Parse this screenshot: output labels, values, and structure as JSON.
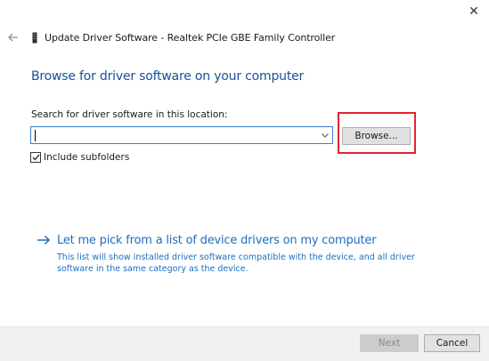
{
  "window": {
    "title": "Update Driver Software - Realtek PCIe GBE Family Controller",
    "close_glyph": "✕"
  },
  "icons": {
    "back": "arrow-left-icon",
    "device": "network-adapter-icon",
    "close": "close-icon",
    "dropdown": "chevron-down-icon",
    "check": "checkmark-icon",
    "link_arrow": "arrow-right-icon"
  },
  "main": {
    "heading": "Browse for driver software on your computer",
    "search_label": "Search for driver software in this location:",
    "path_value": "",
    "browse_label": "Browse...",
    "include_subfolders_label": "Include subfolders",
    "include_subfolders_checked": true,
    "pick_link": "Let me pick from a list of device drivers on my computer",
    "pick_description": "This list will show installed driver software compatible with the device, and all driver software in the same category as the device."
  },
  "footer": {
    "next_label": "Next",
    "next_enabled": false,
    "cancel_label": "Cancel"
  },
  "colors": {
    "heading": "#1b4f9c",
    "link": "#1b6ec2",
    "highlight_box": "#e2242c",
    "input_border": "#3d7bd3"
  }
}
